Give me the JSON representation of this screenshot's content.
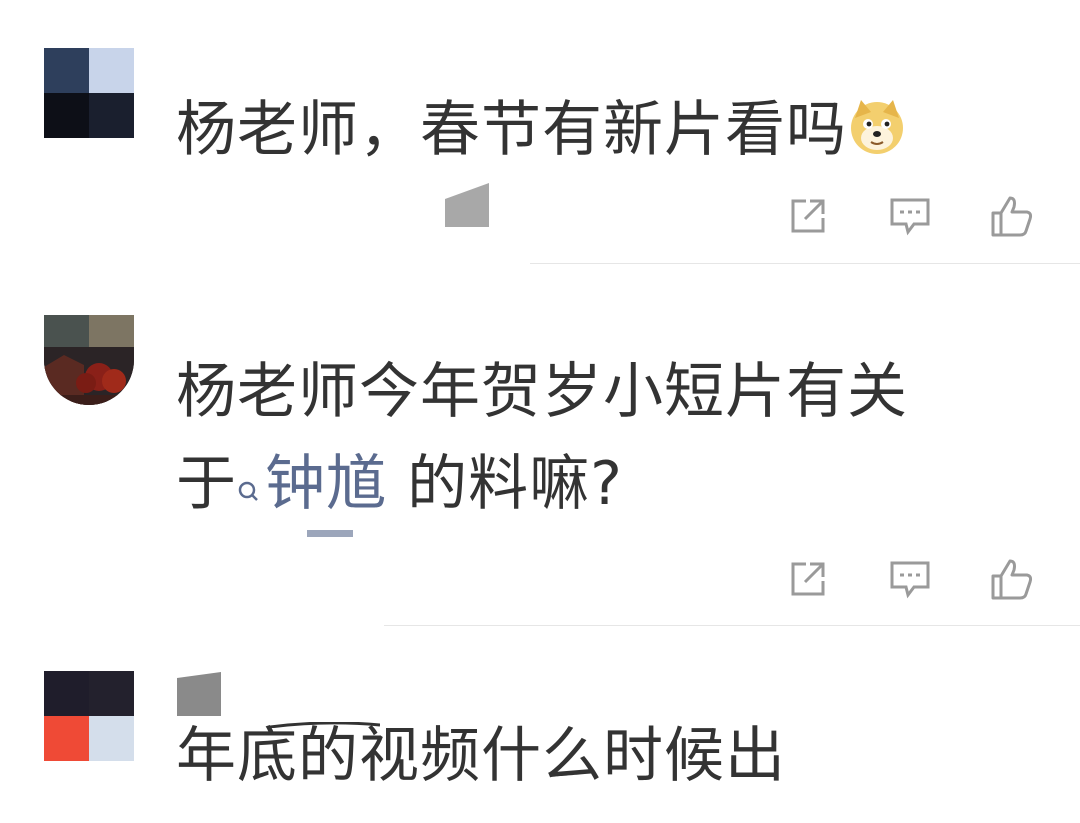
{
  "comments": [
    {
      "text": "杨老师，春节有新片看吗",
      "emoji": "doge-emoji",
      "actions": [
        "share-icon",
        "reply-icon",
        "like-icon"
      ]
    },
    {
      "text_before": "杨老师今年贺岁小短片有关",
      "text_line2_before": "于",
      "topic": "钟馗",
      "text_line2_after": " 的料嘛?",
      "actions": [
        "share-icon",
        "reply-icon",
        "like-icon"
      ]
    },
    {
      "text": "年底的视频什么时候出"
    }
  ],
  "colors": {
    "text": "#333333",
    "topic_link": "#5b6b8f",
    "icon": "#9a9a9a",
    "divider": "#e6e6e6"
  }
}
